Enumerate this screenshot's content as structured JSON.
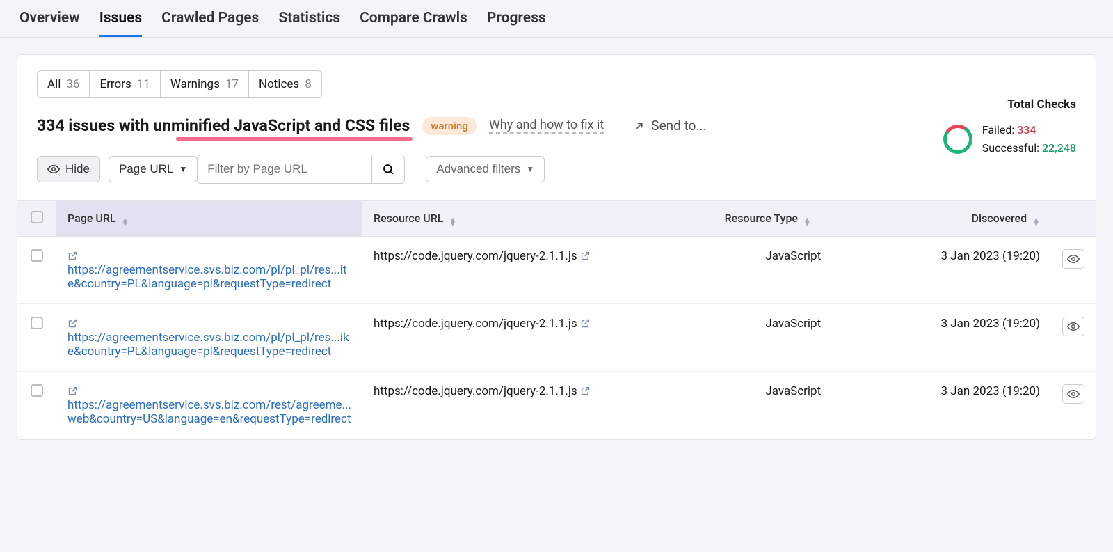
{
  "nav_tabs": [
    "Overview",
    "Issues",
    "Crawled Pages",
    "Statistics",
    "Compare Crawls",
    "Progress"
  ],
  "active_tab_index": 1,
  "filter_pills": [
    {
      "label": "All",
      "count": "36"
    },
    {
      "label": "Errors",
      "count": "11"
    },
    {
      "label": "Warnings",
      "count": "17"
    },
    {
      "label": "Notices",
      "count": "8"
    }
  ],
  "issue_title": "334 issues with unminified JavaScript and CSS files",
  "badge": "warning",
  "fix_link": "Why and how to fix it",
  "send_to": "Send to...",
  "hide_btn": "Hide",
  "page_url_dropdown": "Page URL",
  "filter_placeholder": "Filter by Page URL",
  "advanced_filters": "Advanced filters",
  "totals": {
    "title": "Total Checks",
    "failed_label": "Failed:",
    "failed": "334",
    "successful_label": "Successful:",
    "successful": "22,248"
  },
  "columns": {
    "page_url": "Page URL",
    "resource_url": "Resource URL",
    "resource_type": "Resource Type",
    "discovered": "Discovered"
  },
  "rows": [
    {
      "page_url": "https://agreementservice.svs.biz.com/pl/pl_pl/res...ite&country=PL&language=pl&requestType=redirect",
      "resource_url": "https://code.jquery.com/jquery-2.1.1.js",
      "resource_type": "JavaScript",
      "discovered": "3 Jan 2023 (19:20)"
    },
    {
      "page_url": "https://agreementservice.svs.biz.com/pl/pl_pl/res...ike&country=PL&language=pl&requestType=redirect",
      "resource_url": "https://code.jquery.com/jquery-2.1.1.js",
      "resource_type": "JavaScript",
      "discovered": "3 Jan 2023 (19:20)"
    },
    {
      "page_url": "https://agreementservice.svs.biz.com/rest/agreeme...web&country=US&language=en&requestType=redirect",
      "resource_url": "https://code.jquery.com/jquery-2.1.1.js",
      "resource_type": "JavaScript",
      "discovered": "3 Jan 2023 (19:20)"
    }
  ]
}
